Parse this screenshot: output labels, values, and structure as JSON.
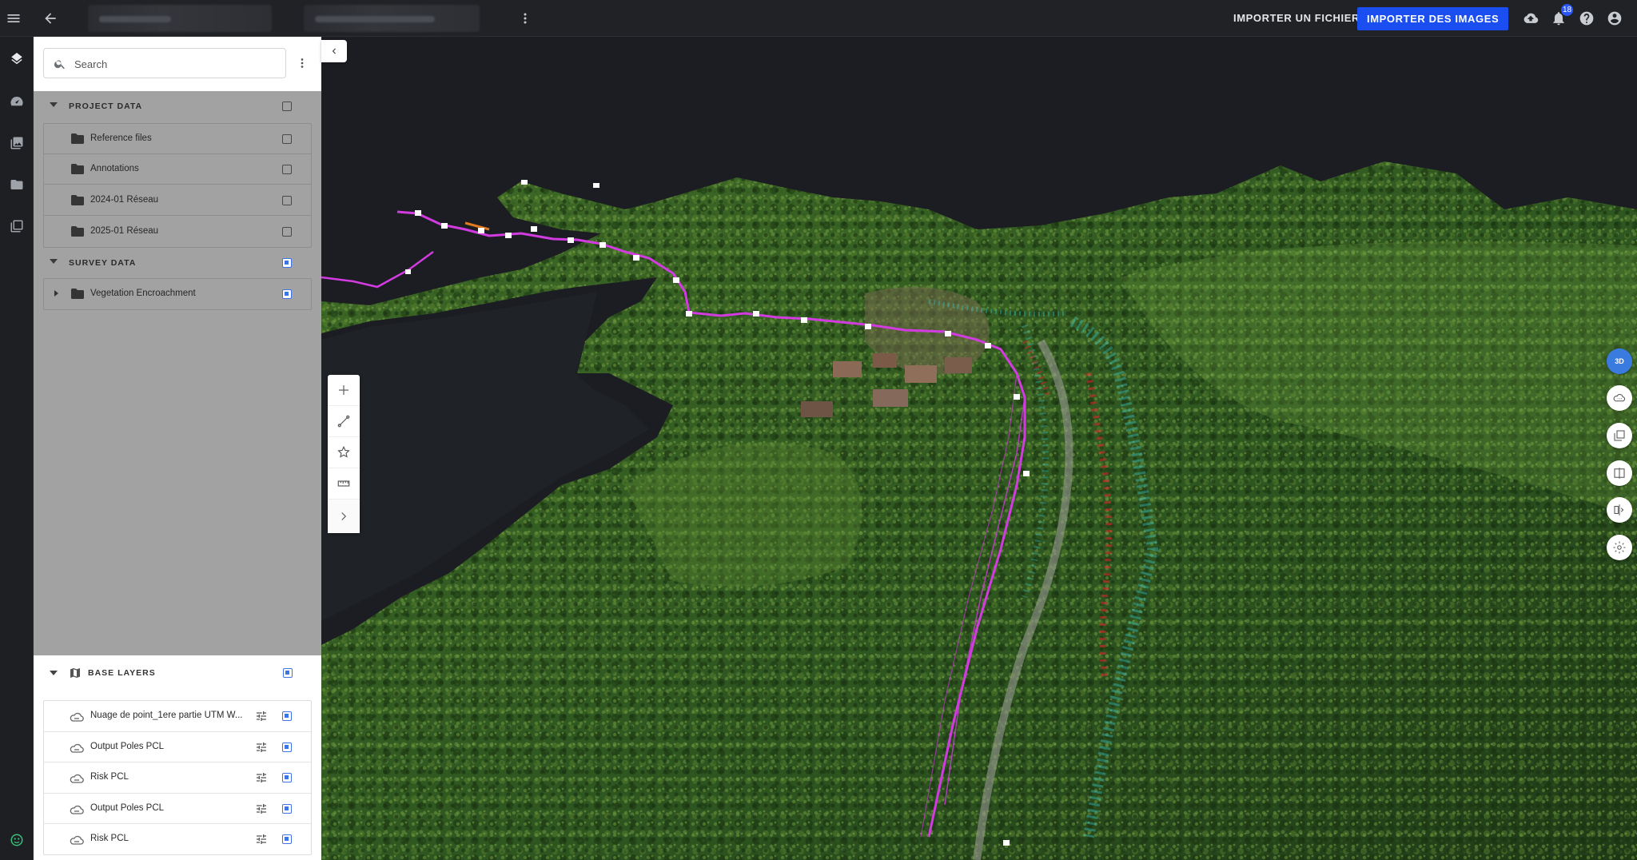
{
  "topbar": {
    "import_file_label": "IMPORTER UN FICHIER",
    "import_images_label": "IMPORTER DES IMAGES",
    "notification_count": "18"
  },
  "search": {
    "placeholder": "Search"
  },
  "project_data": {
    "title": "PROJECT DATA",
    "items": [
      {
        "label": "Reference files"
      },
      {
        "label": "Annotations"
      },
      {
        "label": "2024-01 Réseau"
      },
      {
        "label": "2025-01 Réseau"
      }
    ]
  },
  "survey_data": {
    "title": "SURVEY DATA",
    "items": [
      {
        "label": "Vegetation Encroachment"
      }
    ]
  },
  "base_layers": {
    "title": "BASE LAYERS",
    "items": [
      {
        "label": "Nuage de point_1ere partie UTM W..."
      },
      {
        "label": "Output Poles PCL"
      },
      {
        "label": "Risk PCL"
      },
      {
        "label": "Output Poles PCL"
      },
      {
        "label": "Risk PCL"
      }
    ]
  },
  "view_controls": {
    "mode_label": "3D"
  },
  "colors": {
    "accent": "#1a4ef0",
    "line_magenta": "#d23be0",
    "vegetation_cyan": "#39d8e0",
    "risk_red": "#e0242a"
  }
}
